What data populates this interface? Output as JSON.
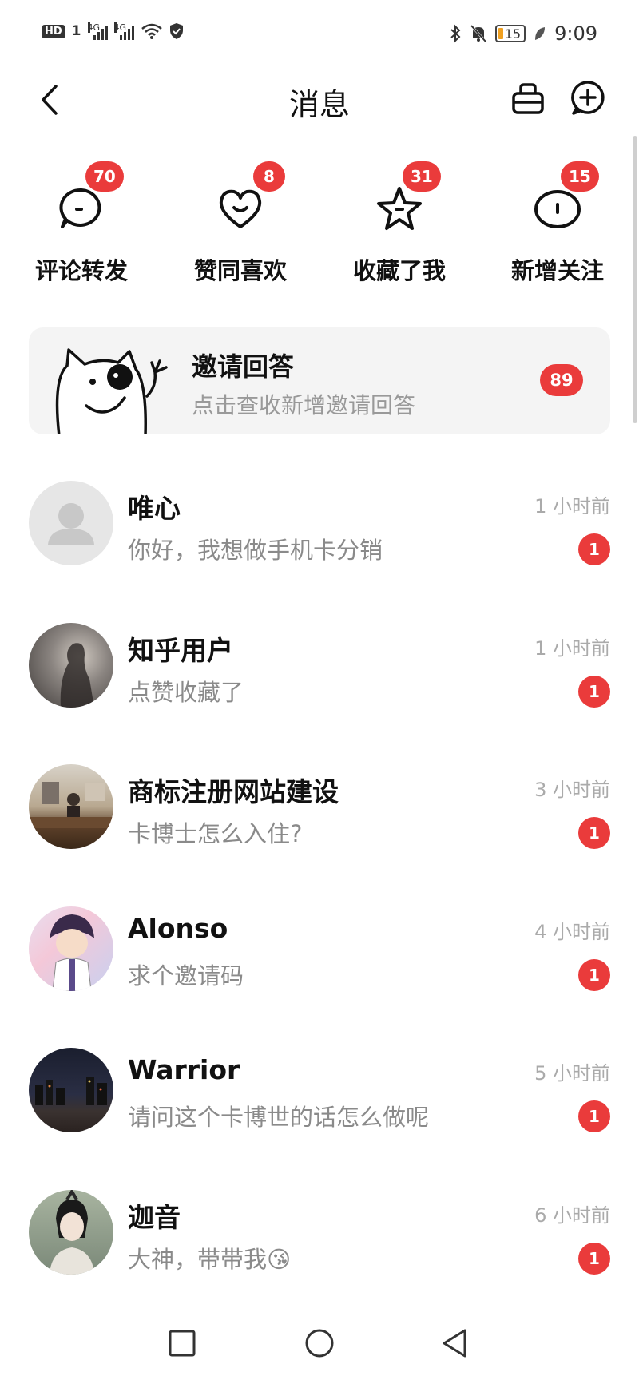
{
  "status_bar": {
    "hd": "HD",
    "sim": "1",
    "net1": "4G",
    "net2": "4G",
    "battery": "15",
    "time": "9:09"
  },
  "header": {
    "title": "消息"
  },
  "categories": [
    {
      "label": "评论转发",
      "badge": "70",
      "icon": "comment-bubble-icon"
    },
    {
      "label": "赞同喜欢",
      "badge": "8",
      "icon": "heart-icon"
    },
    {
      "label": "收藏了我",
      "badge": "31",
      "icon": "star-icon"
    },
    {
      "label": "新增关注",
      "badge": "15",
      "icon": "follow-bubble-icon"
    }
  ],
  "invite": {
    "title": "邀请回答",
    "subtitle": "点击查收新增邀请回答",
    "badge": "89"
  },
  "messages": [
    {
      "name": "唯心",
      "preview": "你好，我想做手机卡分销",
      "time": "1 小时前",
      "count": "1"
    },
    {
      "name": "知乎用户",
      "preview": "点赞收藏了",
      "time": "1 小时前",
      "count": "1"
    },
    {
      "name": "商标注册网站建设",
      "preview": "卡博士怎么入住?",
      "time": "3 小时前",
      "count": "1"
    },
    {
      "name": "Alonso",
      "preview": "求个邀请码",
      "time": "4 小时前",
      "count": "1"
    },
    {
      "name": "Warrior",
      "preview": "请问这个卡博世的话怎么做呢",
      "time": "5 小时前",
      "count": "1"
    },
    {
      "name": "迦音",
      "preview": "大神，带带我😘",
      "time": "6 小时前",
      "count": "1"
    }
  ],
  "colors": {
    "badge": "#ea3b3b",
    "card_bg": "#f4f4f4",
    "muted_text": "#8a8a8a"
  }
}
